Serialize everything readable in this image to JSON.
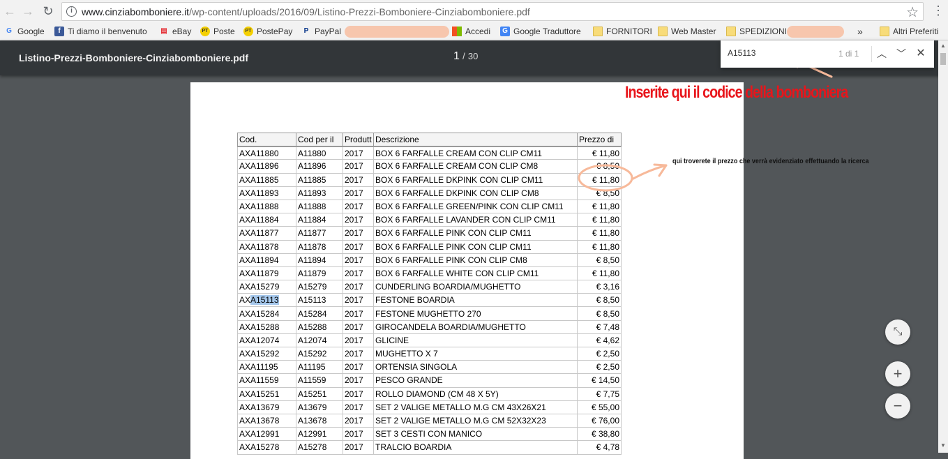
{
  "browser": {
    "url_domain": "www.cinziabomboniere.it",
    "url_path": "/wp-content/uploads/2016/09/Listino-Prezzi-Bomboniere-Cinziabomboniere.pdf",
    "info_icon": "i"
  },
  "bookmarks": [
    {
      "label": "Google",
      "icon": "G",
      "color": "#4285f4"
    },
    {
      "label": "Ti diamo il benvenuto",
      "icon": "f",
      "color": "#3b5998"
    },
    {
      "label": "eBay",
      "icon": "e",
      "color": "#e53238"
    },
    {
      "label": "Poste",
      "icon": "PT",
      "color": "#f5d000"
    },
    {
      "label": "PostePay",
      "icon": "PT",
      "color": "#f5d000"
    },
    {
      "label": "PayPal",
      "icon": "P",
      "color": "#003087"
    },
    {
      "label": "Accedi",
      "icon": "ms",
      "color": "#f25022"
    },
    {
      "label": "Google Traduttore",
      "icon": "G",
      "color": "#4285f4"
    },
    {
      "label": "FORNITORI",
      "icon": "folder"
    },
    {
      "label": "Web Master",
      "icon": "folder"
    },
    {
      "label": "SPEDIZIONI",
      "icon": "folder"
    },
    {
      "label": "»",
      "icon": ""
    },
    {
      "label": "Altri Preferiti",
      "icon": "folder"
    }
  ],
  "pdf": {
    "title": "Listino-Prezzi-Bomboniere-Cinziabomboniere.pdf",
    "current_page": "1",
    "separator": "/",
    "total_pages": "30"
  },
  "find": {
    "query": "A15113",
    "count": "1 di 1"
  },
  "annotations": {
    "main": "Inserite qui il codice della bomboniera",
    "sub": "qui troverete il prezzo che verrà evidenziato effettuando la ricerca"
  },
  "table": {
    "headers": [
      "Cod.",
      "Cod per il",
      "Produtt",
      "Descrizione",
      "Prezzo di"
    ],
    "rows": [
      [
        "AXA11880",
        "A11880",
        "2017",
        "BOX 6 FARFALLE CREAM CON CLIP CM11",
        "€ 11,80"
      ],
      [
        "AXA11896",
        "A11896",
        "2017",
        "BOX 6 FARFALLE CREAM CON CLIP CM8",
        "€ 8,50"
      ],
      [
        "AXA11885",
        "A11885",
        "2017",
        "BOX 6 FARFALLE DKPINK CON CLIP CM11",
        "€ 11,80"
      ],
      [
        "AXA11893",
        "A11893",
        "2017",
        "BOX 6 FARFALLE DKPINK CON CLIP CM8",
        "€ 8,50"
      ],
      [
        "AXA11888",
        "A11888",
        "2017",
        "BOX 6 FARFALLE GREEN/PINK CON CLIP CM11",
        "€ 11,80"
      ],
      [
        "AXA11884",
        "A11884",
        "2017",
        "BOX 6 FARFALLE LAVANDER CON CLIP CM11",
        "€ 11,80"
      ],
      [
        "AXA11877",
        "A11877",
        "2017",
        "BOX 6 FARFALLE PINK CON CLIP CM11",
        "€ 11,80"
      ],
      [
        "AXA11878",
        "A11878",
        "2017",
        "BOX 6 FARFALLE PINK CON CLIP CM11",
        "€ 11,80"
      ],
      [
        "AXA11894",
        "A11894",
        "2017",
        "BOX 6 FARFALLE PINK CON CLIP CM8",
        "€ 8,50"
      ],
      [
        "AXA11879",
        "A11879",
        "2017",
        "BOX 6 FARFALLE WHITE CON CLIP CM11",
        "€ 11,80"
      ],
      [
        "AXA15279",
        "A15279",
        "2017",
        "CUNDERLING BOARDIA/MUGHETTO",
        "€ 3,16"
      ],
      [
        "AXA15113",
        "A15113",
        "2017",
        "FESTONE BOARDIA",
        "€ 8,50"
      ],
      [
        "AXA15284",
        "A15284",
        "2017",
        "FESTONE MUGHETTO 270",
        "€ 8,50"
      ],
      [
        "AXA15288",
        "A15288",
        "2017",
        "GIROCANDELA BOARDIA/MUGHETTO",
        "€ 7,48"
      ],
      [
        "AXA12074",
        "A12074",
        "2017",
        "GLICINE",
        "€ 4,62"
      ],
      [
        "AXA15292",
        "A15292",
        "2017",
        "MUGHETTO X 7",
        "€ 2,50"
      ],
      [
        "AXA11195",
        "A11195",
        "2017",
        "ORTENSIA SINGOLA",
        "€ 2,50"
      ],
      [
        "AXA11559",
        "A11559",
        "2017",
        "PESCO GRANDE",
        "€ 14,50"
      ],
      [
        "AXA15251",
        "A15251",
        "2017",
        "ROLLO DIAMOND (CM 48 X 5Y)",
        "€ 7,75"
      ],
      [
        "AXA13679",
        "A13679",
        "2017",
        "SET 2 VALIGE METALLO M.G CM 43X26X21",
        "€ 55,00"
      ],
      [
        "AXA13678",
        "A13678",
        "2017",
        "SET 2 VALIGE METALLO M.G CM 52X32X23",
        "€ 76,00"
      ],
      [
        "AXA12991",
        "A12991",
        "2017",
        "SET 3 CESTI CON MANICO",
        "€ 38,80"
      ],
      [
        "AXA15278",
        "A15278",
        "2017",
        "TRALCIO BOARDIA",
        "€ 4,78"
      ]
    ],
    "highlight_row": 11,
    "highlight_prefix": "AX",
    "highlight_match": "A15113"
  },
  "colors": {
    "annotation_red": "#e8151b",
    "annotation_orange": "#f7b99a",
    "search_highlight": "#a6c8ec"
  },
  "icons": {
    "back": "arrow-left-icon",
    "forward": "arrow-right-icon",
    "reload": "reload-icon",
    "star": "star-icon",
    "menu": "kebab-menu-icon",
    "find_prev": "chevron-up-icon",
    "find_next": "chevron-down-icon",
    "find_close": "close-icon",
    "fit": "fit-page-icon",
    "zoom_in": "plus-icon",
    "zoom_out": "minus-icon"
  }
}
